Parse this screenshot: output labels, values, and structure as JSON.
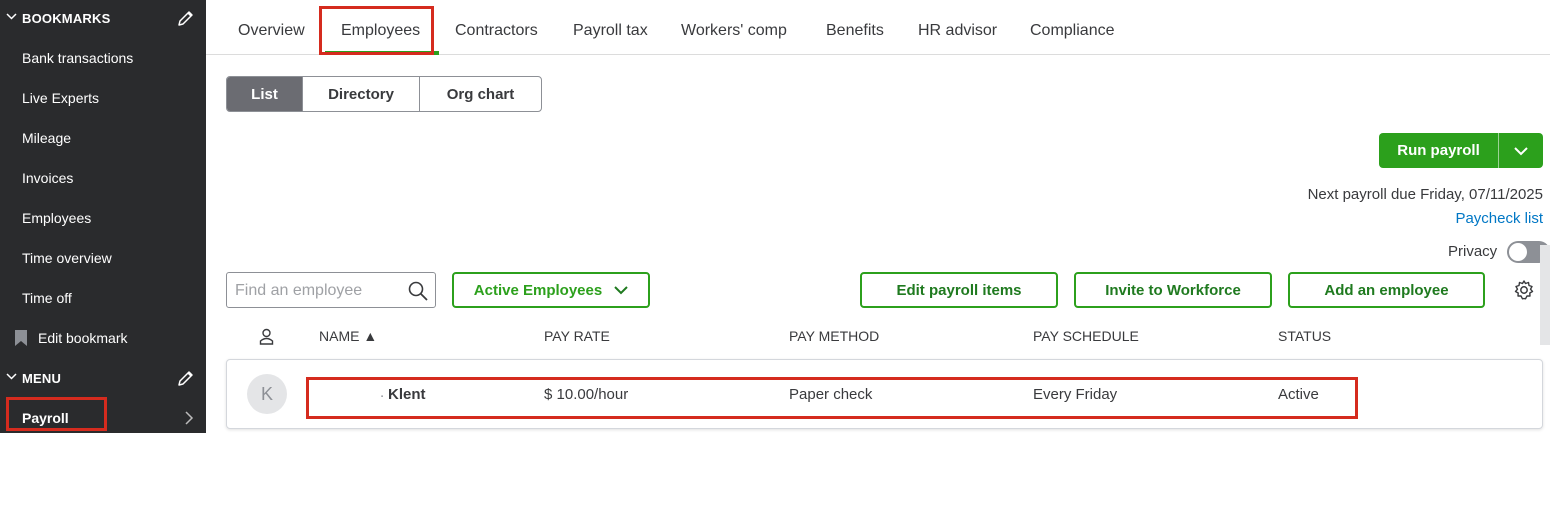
{
  "sidebar": {
    "bookmarks_header": "BOOKMARKS",
    "bookmarks": [
      {
        "label": "Bank transactions"
      },
      {
        "label": "Live Experts"
      },
      {
        "label": "Mileage"
      },
      {
        "label": "Invoices"
      },
      {
        "label": "Employees"
      },
      {
        "label": "Time overview"
      },
      {
        "label": "Time off"
      }
    ],
    "edit_bookmark": "Edit bookmark",
    "menu_header": "MENU",
    "menu_items": [
      {
        "label": "Payroll"
      }
    ]
  },
  "tabs": [
    {
      "label": "Overview"
    },
    {
      "label": "Employees",
      "active": true
    },
    {
      "label": "Contractors"
    },
    {
      "label": "Payroll tax"
    },
    {
      "label": "Workers' comp"
    },
    {
      "label": "Benefits"
    },
    {
      "label": "HR advisor"
    },
    {
      "label": "Compliance"
    }
  ],
  "view_toggle": {
    "options": [
      "List",
      "Directory",
      "Org chart"
    ],
    "selected": "List"
  },
  "run_payroll": {
    "label": "Run payroll",
    "next_due": "Next payroll due Friday, 07/11/2025",
    "paycheck_list": "Paycheck list"
  },
  "privacy": {
    "label": "Privacy",
    "enabled": false
  },
  "toolbar": {
    "search_placeholder": "Find an employee",
    "filter_label": "Active Employees",
    "edit_payroll_items": "Edit payroll items",
    "invite_workforce": "Invite to Workforce",
    "add_employee": "Add an employee"
  },
  "table": {
    "columns": [
      "NAME ▲",
      "PAY RATE",
      "PAY METHOD",
      "PAY SCHEDULE",
      "STATUS"
    ],
    "rows": [
      {
        "initial": "K",
        "name": "Klent",
        "name_prefix": ".",
        "pay_rate": "$ 10.00/hour",
        "pay_method": "Paper check",
        "pay_schedule": "Every Friday",
        "status": "Active"
      }
    ]
  },
  "colors": {
    "sidebar_bg": "#2a2b2d",
    "accent_green": "#2ca01c",
    "link_blue": "#0077c5",
    "highlight_red": "#d52b1e"
  }
}
